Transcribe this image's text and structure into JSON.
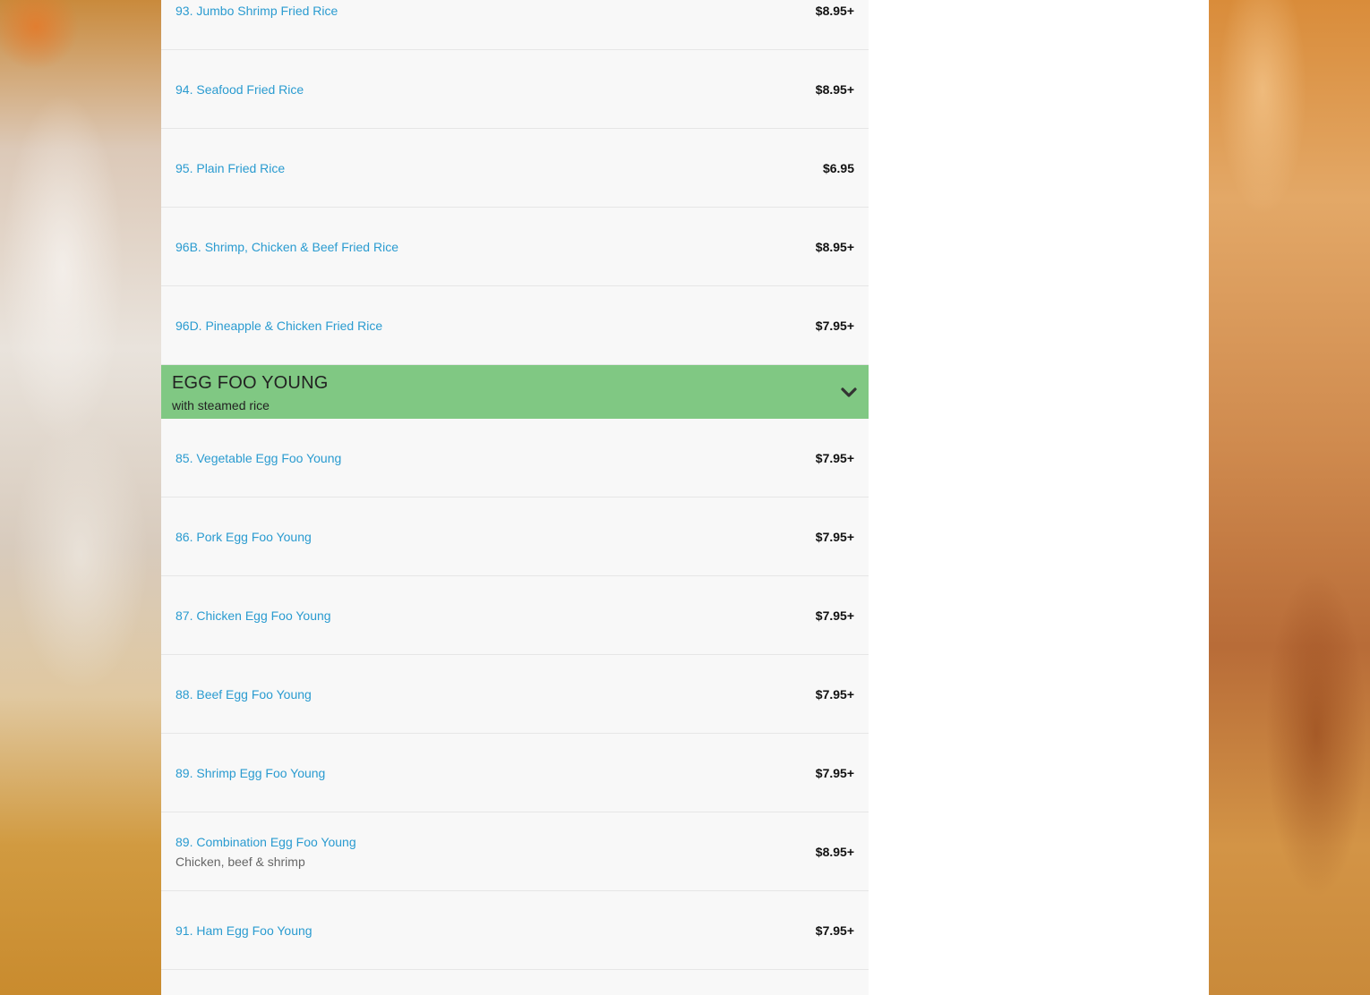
{
  "fried_rice_items": [
    {
      "name": "93. Jumbo Shrimp Fried Rice",
      "price": "$8.95+"
    },
    {
      "name": "94. Seafood Fried Rice",
      "price": "$8.95+"
    },
    {
      "name": "95. Plain Fried Rice",
      "price": "$6.95"
    },
    {
      "name": "96B. Shrimp, Chicken & Beef Fried Rice",
      "price": "$8.95+"
    },
    {
      "name": "96D. Pineapple & Chicken Fried Rice",
      "price": "$7.95+"
    }
  ],
  "egg_foo_young": {
    "title": "EGG FOO YOUNG",
    "subtitle": "with steamed rice",
    "toggle_icon": "chevron-down-icon",
    "header_color": "#80c883",
    "items": [
      {
        "name": "85. Vegetable Egg Foo Young",
        "price": "$7.95+"
      },
      {
        "name": "86. Pork Egg Foo Young",
        "price": "$7.95+"
      },
      {
        "name": "87. Chicken Egg Foo Young",
        "price": "$7.95+"
      },
      {
        "name": "88. Beef Egg Foo Young",
        "price": "$7.95+"
      },
      {
        "name": "89. Shrimp Egg Foo Young",
        "price": "$7.95+"
      },
      {
        "name": "89. Combination Egg Foo Young",
        "desc": "Chicken, beef & shrimp",
        "price": "$8.95+"
      },
      {
        "name": "91. Ham Egg Foo Young",
        "price": "$7.95+"
      }
    ]
  },
  "colors": {
    "item_name": "#2a9bd0",
    "price": "#111111"
  }
}
